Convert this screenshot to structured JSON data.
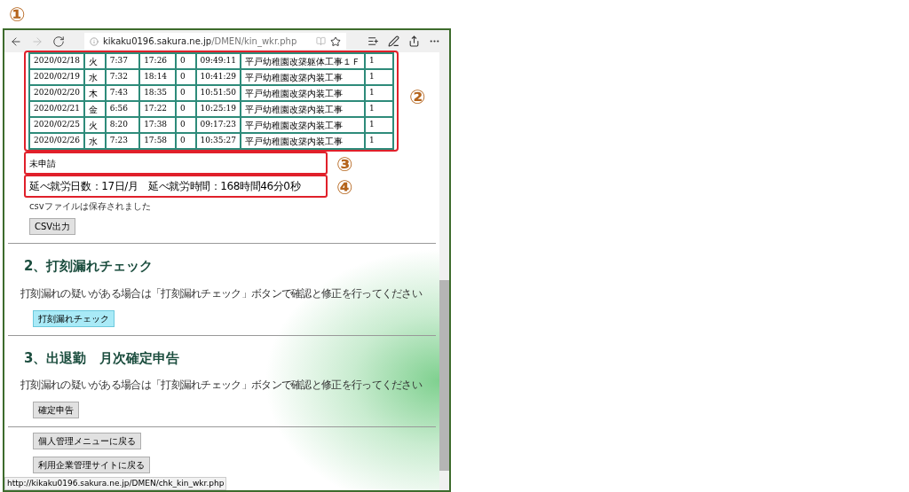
{
  "annotations": {
    "browser": "①",
    "table": "②",
    "status": "③",
    "totals": "④"
  },
  "browser": {
    "nav": [
      {
        "kind": "back",
        "disabled": false
      },
      {
        "kind": "forward",
        "disabled": true
      },
      {
        "kind": "refresh",
        "disabled": false
      }
    ],
    "url_host": "kikaku0196.sakura.ne.jp",
    "url_path": "/DMEN/kin_wkr.php"
  },
  "table": {
    "rows": [
      [
        "2020/02/18",
        "火",
        "7:37",
        "17:26",
        "0",
        "09:49:11",
        "平戸幼稚園改築躯体工事１Ｆ",
        "1"
      ],
      [
        "2020/02/19",
        "水",
        "7:32",
        "18:14",
        "0",
        "10:41:29",
        "平戸幼稚園改築内装工事",
        "1"
      ],
      [
        "2020/02/20",
        "木",
        "7:43",
        "18:35",
        "0",
        "10:51:50",
        "平戸幼稚園改築内装工事",
        "1"
      ],
      [
        "2020/02/21",
        "金",
        "6:56",
        "17:22",
        "0",
        "10:25:19",
        "平戸幼稚園改築内装工事",
        "1"
      ],
      [
        "2020/02/25",
        "火",
        "8:20",
        "17:38",
        "0",
        "09:17:23",
        "平戸幼稚園改築内装工事",
        "1"
      ],
      [
        "2020/02/26",
        "水",
        "7:23",
        "17:58",
        "0",
        "10:35:27",
        "平戸幼稚園改築内装工事",
        "1"
      ]
    ]
  },
  "application_status": "未申請",
  "totals": "延べ就労日数：17日/月　延べ就労時間：168時間46分0秒",
  "csv_message": "csvファイルは保存されました",
  "csv_button": "CSV出力",
  "sections": [
    {
      "heading": "2、打刻漏れチェック",
      "text": "打刻漏れの疑いがある場合は「打刻漏れチェック」ボタンで確認と修正を行ってください",
      "button": "打刻漏れチェック",
      "highlighted": true
    },
    {
      "heading": "3、出退勤　月次確定申告",
      "text": "打刻漏れの疑いがある場合は「打刻漏れチェック」ボタンで確認と修正を行ってください",
      "button": "確定申告",
      "highlighted": false
    }
  ],
  "footer_buttons": [
    "個人管理メニューに戻る",
    "利用企業管理サイトに戻る"
  ],
  "status_url": "http://kikaku0196.sakura.ne.jp/DMEN/chk_kin_wkr.php"
}
